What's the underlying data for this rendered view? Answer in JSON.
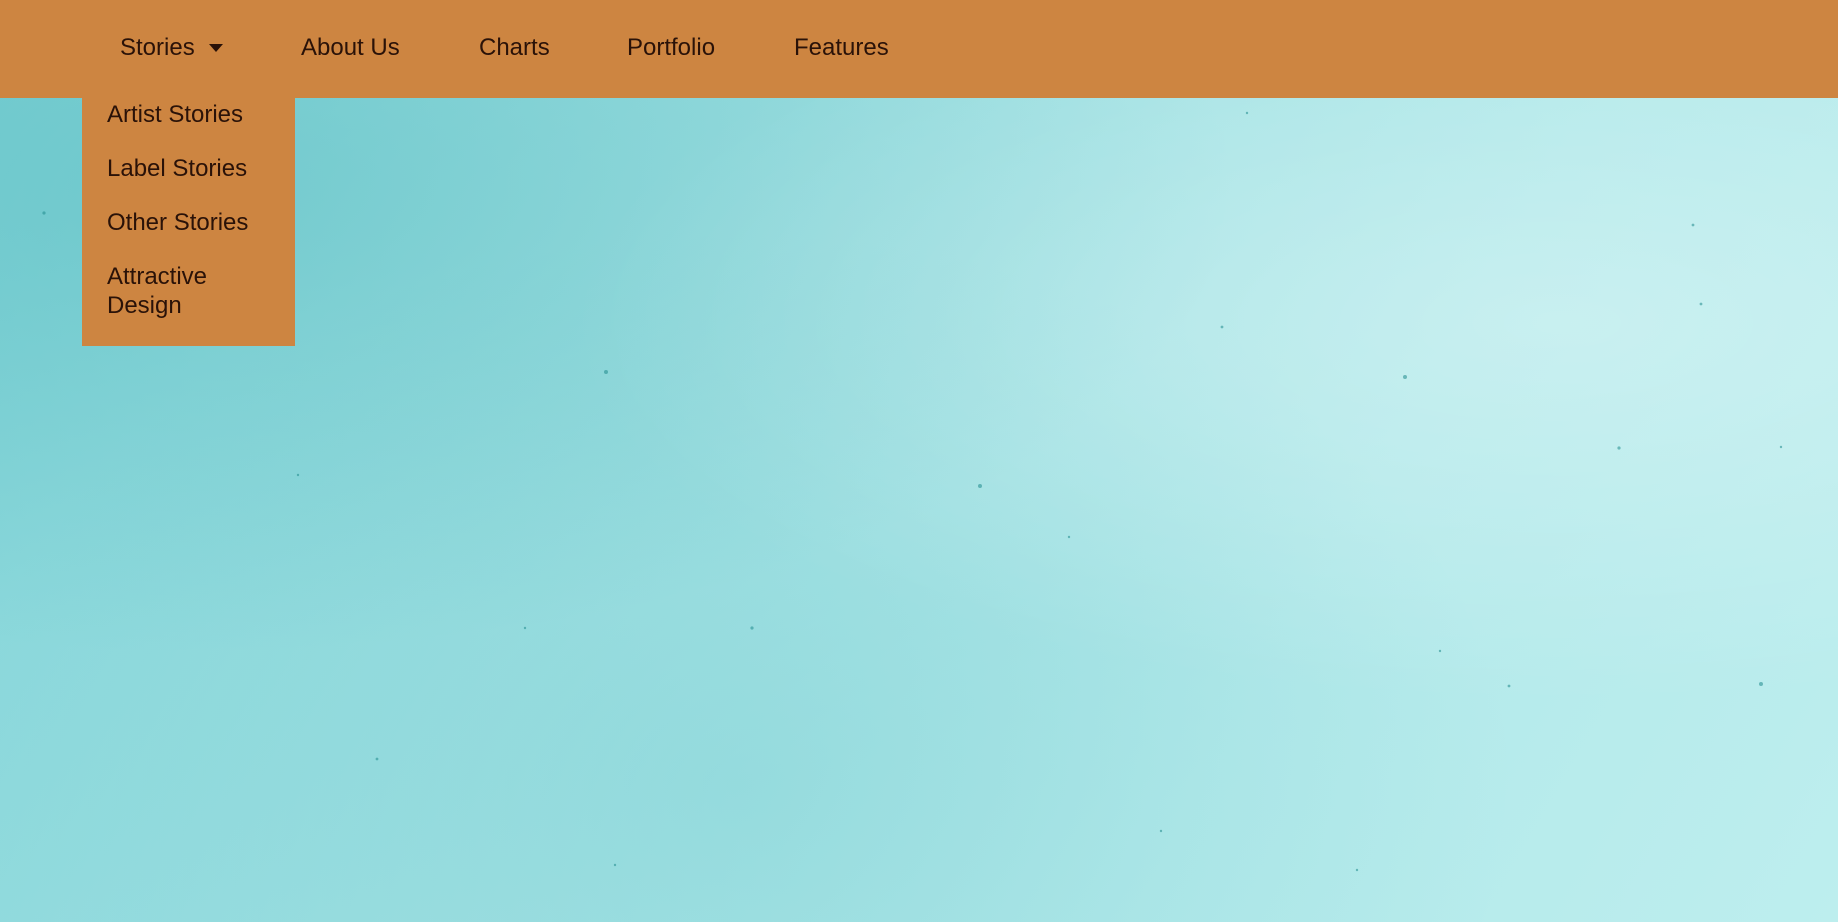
{
  "nav": {
    "items": [
      {
        "label": "Stories",
        "has_dropdown": true
      },
      {
        "label": "About Us"
      },
      {
        "label": "Charts"
      },
      {
        "label": "Portfolio"
      },
      {
        "label": "Features"
      }
    ]
  },
  "dropdown": {
    "items": [
      {
        "label": "Artist Stories"
      },
      {
        "label": "Label Stories"
      },
      {
        "label": "Other Stories"
      },
      {
        "label": "Attractive Design"
      }
    ]
  },
  "icons": {
    "stories_caret": "caret-down-icon"
  },
  "colors": {
    "nav_background": "#cd8541",
    "nav_text": "#2a1208",
    "page_background": "#9fe0e2"
  }
}
